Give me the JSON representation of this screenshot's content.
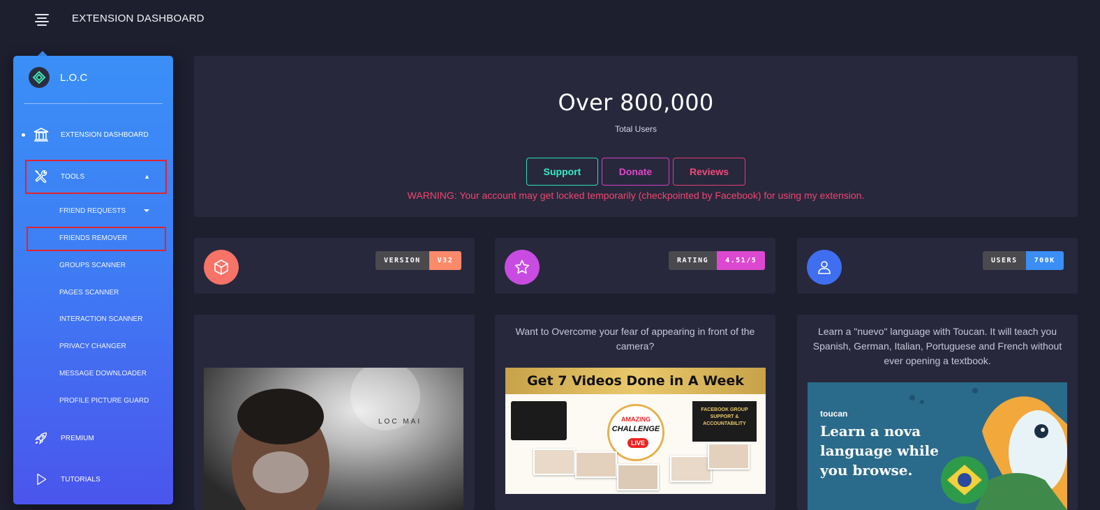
{
  "header": {
    "title": "EXTENSION DASHBOARD"
  },
  "sidebar": {
    "brand": "L.O.C",
    "items": [
      {
        "label": "EXTENSION DASHBOARD",
        "icon": "bank-icon",
        "active": true
      },
      {
        "label": "TOOLS",
        "icon": "tools-icon",
        "expanded": true
      },
      {
        "label": "PREMIUM",
        "icon": "rocket-icon"
      },
      {
        "label": "TUTORIALS",
        "icon": "play-icon"
      }
    ],
    "tools_submenu": [
      {
        "label": "FRIEND REQUESTS",
        "has_caret": true
      },
      {
        "label": "FRIENDS REMOVER"
      },
      {
        "label": "GROUPS SCANNER"
      },
      {
        "label": "PAGES SCANNER"
      },
      {
        "label": "INTERACTION SCANNER"
      },
      {
        "label": "PRIVACY CHANGER"
      },
      {
        "label": "MESSAGE DOWNLOADER"
      },
      {
        "label": "PROFILE PICTURE GUARD"
      }
    ]
  },
  "hero": {
    "title": "Over 800,000",
    "subtitle": "Total Users",
    "buttons": {
      "support": "Support",
      "donate": "Donate",
      "reviews": "Reviews"
    },
    "warning": "WARNING: Your account may get locked temporarily (checkpointed by Facebook) for using my extension."
  },
  "stats": [
    {
      "label": "VERSION",
      "value": "V32",
      "icon": "box-icon",
      "color": "#f7715f",
      "value_color": "#fb8a6b"
    },
    {
      "label": "RATING",
      "value": "4.51/5",
      "icon": "star-icon",
      "color": "#c54de0",
      "value_color": "#dc49d0"
    },
    {
      "label": "USERS",
      "value": "700K",
      "icon": "user-icon",
      "color": "#3f72f0",
      "value_color": "#3a8ef5"
    }
  ],
  "promos": {
    "profile": {
      "watermark": "LOC MAI"
    },
    "camera": {
      "text": "Want to Overcome your fear of appearing in front of the camera?",
      "banner": "Get 7 Videos Done in A Week",
      "challenge_line1": "AMAZING",
      "challenge_line2": "CHALLENGE",
      "challenge_live": "LIVE",
      "fb_box": "FACEBOOK GROUP SUPPORT & ACCOUNTABILITY"
    },
    "toucan": {
      "text": "Learn a \"nuevo\" language with Toucan. It will teach you Spanish, German, Italian, Portuguese and French without ever opening a textbook.",
      "brand": "toucan",
      "headline_line1": "Learn a nova",
      "headline_line2": "language while",
      "headline_line3": "you browse."
    }
  }
}
